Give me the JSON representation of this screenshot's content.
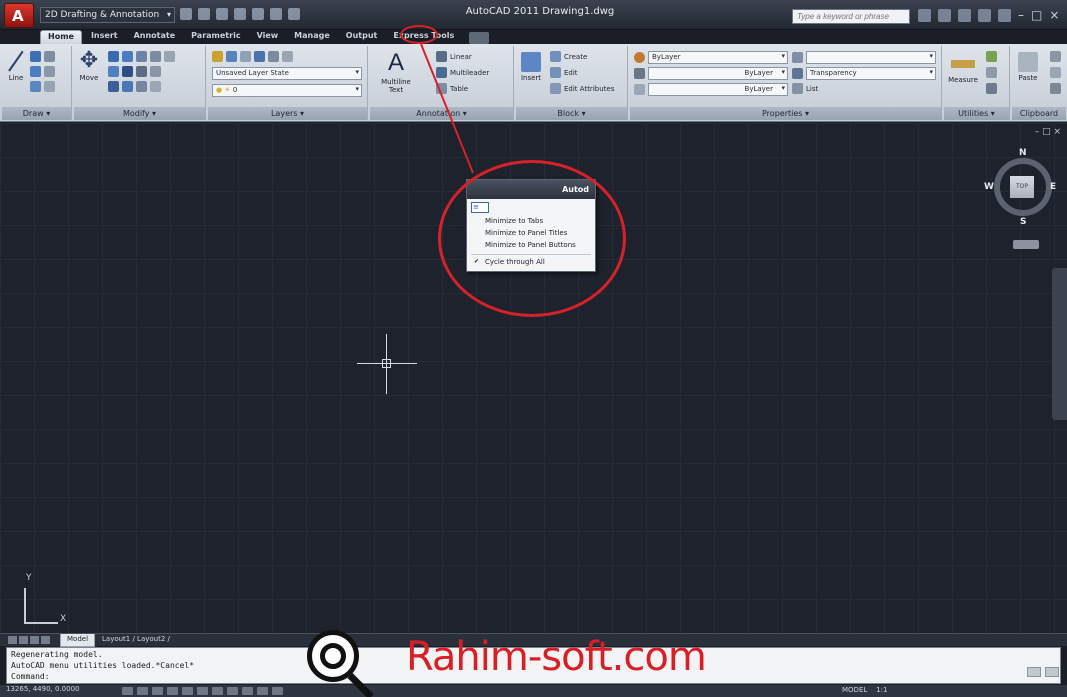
{
  "titlebar": {
    "workspace": "2D Drafting & Annotation",
    "app_title": "AutoCAD 2011   Drawing1.dwg",
    "search_placeholder": "Type a keyword or phrase"
  },
  "tabs": [
    "Home",
    "Insert",
    "Annotate",
    "Parametric",
    "View",
    "Manage",
    "Output",
    "Express Tools"
  ],
  "ribbon": {
    "draw": {
      "title": "Draw",
      "line": "Line"
    },
    "modify": {
      "title": "Modify",
      "move": "Move"
    },
    "layers": {
      "title": "Layers",
      "layer_state": "Unsaved Layer State",
      "layer_current": "0"
    },
    "annotation": {
      "title": "Annotation",
      "mtext": "Multiline Text",
      "linear": "Linear",
      "multileader": "Multileader",
      "table": "Table"
    },
    "block": {
      "title": "Block",
      "insert": "Insert",
      "create": "Create",
      "edit": "Edit",
      "edit_attributes": "Edit Attributes"
    },
    "properties": {
      "title": "Properties",
      "color": "ByLayer",
      "linetype": "ByLayer",
      "lineweight": "ByLayer",
      "transparency": "Transparency",
      "list": "List"
    },
    "utilities": {
      "title": "Utilities",
      "measure": "Measure"
    },
    "clipboard": {
      "title": "Clipboard",
      "paste": "Paste"
    }
  },
  "popup": {
    "header": "Autod",
    "combo": "≡",
    "items": [
      "Minimize to Tabs",
      "Minimize to Panel Titles",
      "Minimize to Panel Buttons"
    ],
    "cycle": "Cycle through All"
  },
  "viewcube": {
    "n": "N",
    "s": "S",
    "e": "E",
    "w": "W",
    "face": "TOP"
  },
  "ucs": {
    "x": "X",
    "y": "Y"
  },
  "layout_tabs": {
    "model": "Model",
    "others": "Layout1 / Layout2 /"
  },
  "command_lines": [
    "Regenerating model.",
    "AutoCAD menu utilities loaded.*Cancel*",
    "Command:"
  ],
  "status": {
    "coords": "13265, 4490, 0.0000",
    "model": "MODEL",
    "scale": "1:1"
  },
  "watermark": "Rahim-soft.com",
  "colors": {
    "annotation_red": "#d5222a",
    "canvas": "#1d222c"
  }
}
